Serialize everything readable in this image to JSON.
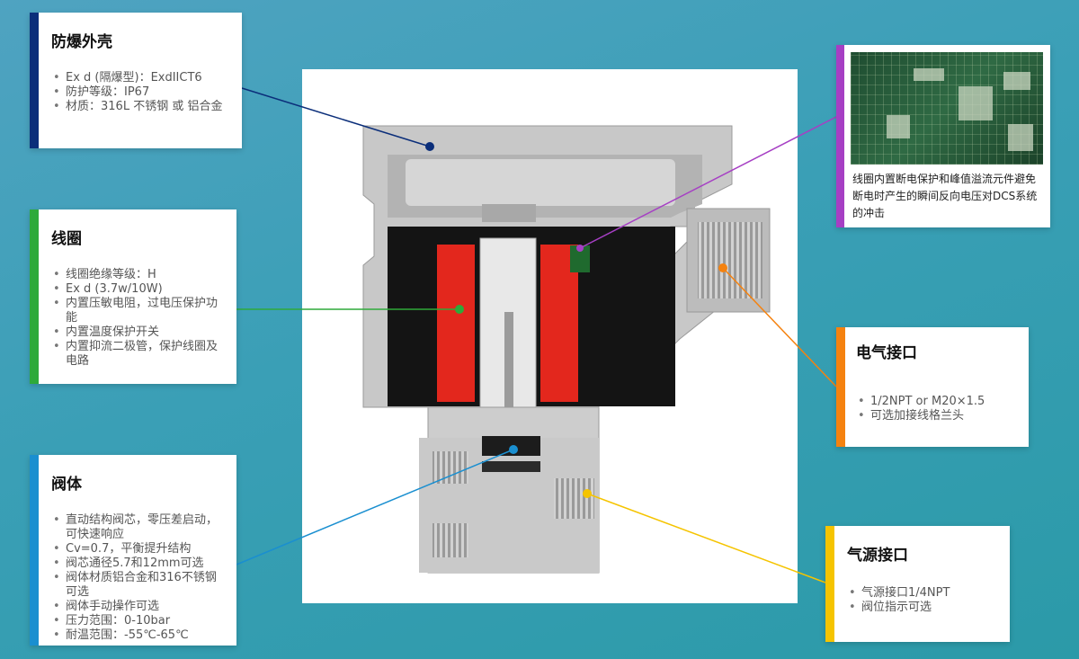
{
  "colors": {
    "shell": "#0b2e7a",
    "coil": "#2eaa3a",
    "valve": "#1a8fd0",
    "electrical": "#f5820f",
    "air": "#f5c400",
    "pcb": "#a63fc4",
    "coil_red": "#e3271d"
  },
  "callouts": {
    "shell": {
      "title": "防爆外壳",
      "items": [
        "Ex d (隔爆型)：ExdIICT6",
        "防护等级：IP67",
        "材质：316L 不锈钢 或 铝合金"
      ]
    },
    "coil": {
      "title": "线圈",
      "items": [
        "线圈绝缘等级：H",
        "Ex d (3.7w/10W)",
        "内置压敏电阻，过电压保护功能",
        "内置温度保护开关",
        "内置抑流二极管，保护线圈及电路"
      ]
    },
    "valve": {
      "title": "阀体",
      "items": [
        "直动结构阀芯，零压差启动，可快速响应",
        "Cv=0.7，平衡提升结构",
        "阀芯通径5.7和12mm可选",
        "阀体材质铝合金和316不锈钢可选",
        "阀体手动操作可选",
        "压力范围：0-10bar",
        "耐温范围：-55℃-65℃"
      ]
    },
    "electrical": {
      "title": "电气接口",
      "items": [
        "1/2NPT or M20×1.5",
        "可选加接线格兰头"
      ]
    },
    "air": {
      "title": "气源接口",
      "items": [
        "气源接口1/4NPT",
        "阀位指示可选"
      ]
    },
    "pcb": {
      "caption": "线圈内置断电保护和峰值溢流元件避免断电时产生的瞬间反向电压对DCS系统的冲击"
    }
  }
}
